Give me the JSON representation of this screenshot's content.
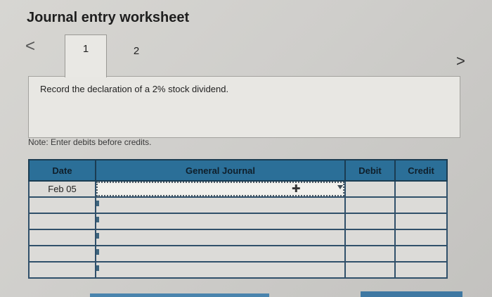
{
  "header": {
    "title": "Journal entry worksheet"
  },
  "navigation": {
    "prev": "<",
    "next": ">"
  },
  "tabs": [
    {
      "label": "1"
    },
    {
      "label": "2"
    }
  ],
  "prompt": {
    "text": "Record the declaration of a 2% stock dividend."
  },
  "note": "Note: Enter debits before credits.",
  "journal": {
    "headers": {
      "date": "Date",
      "general_journal": "General Journal",
      "debit": "Debit",
      "credit": "Credit"
    },
    "rows": [
      {
        "date": "Feb 05",
        "general_journal": "",
        "debit": "",
        "credit": ""
      },
      {
        "date": "",
        "general_journal": "",
        "debit": "",
        "credit": ""
      },
      {
        "date": "",
        "general_journal": "",
        "debit": "",
        "credit": ""
      },
      {
        "date": "",
        "general_journal": "",
        "debit": "",
        "credit": ""
      },
      {
        "date": "",
        "general_journal": "",
        "debit": "",
        "credit": ""
      },
      {
        "date": "",
        "general_journal": "",
        "debit": "",
        "credit": ""
      }
    ]
  },
  "icons": {
    "prev": "chevron-left-icon",
    "next": "chevron-right-icon",
    "dropdown": "chevron-down-icon",
    "cursor": "move-cursor-icon"
  }
}
